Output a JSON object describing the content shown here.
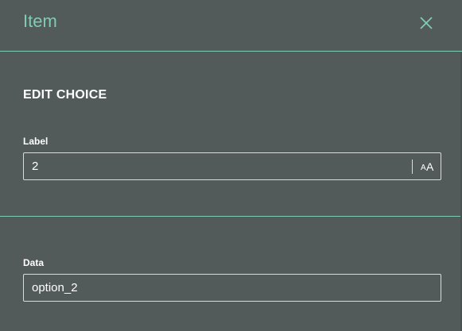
{
  "header": {
    "title": "Item",
    "close_icon": "close-icon"
  },
  "section": {
    "title": "EDIT CHOICE"
  },
  "label_field": {
    "caption": "Label",
    "value": "2",
    "text_size_icon": "text-size-icon"
  },
  "data_field": {
    "caption": "Data",
    "value": "option_2"
  },
  "colors": {
    "accent": "#7fcbb3",
    "background": "#525a5a",
    "text": "#ffffff",
    "input_border": "#d8dcdc"
  }
}
